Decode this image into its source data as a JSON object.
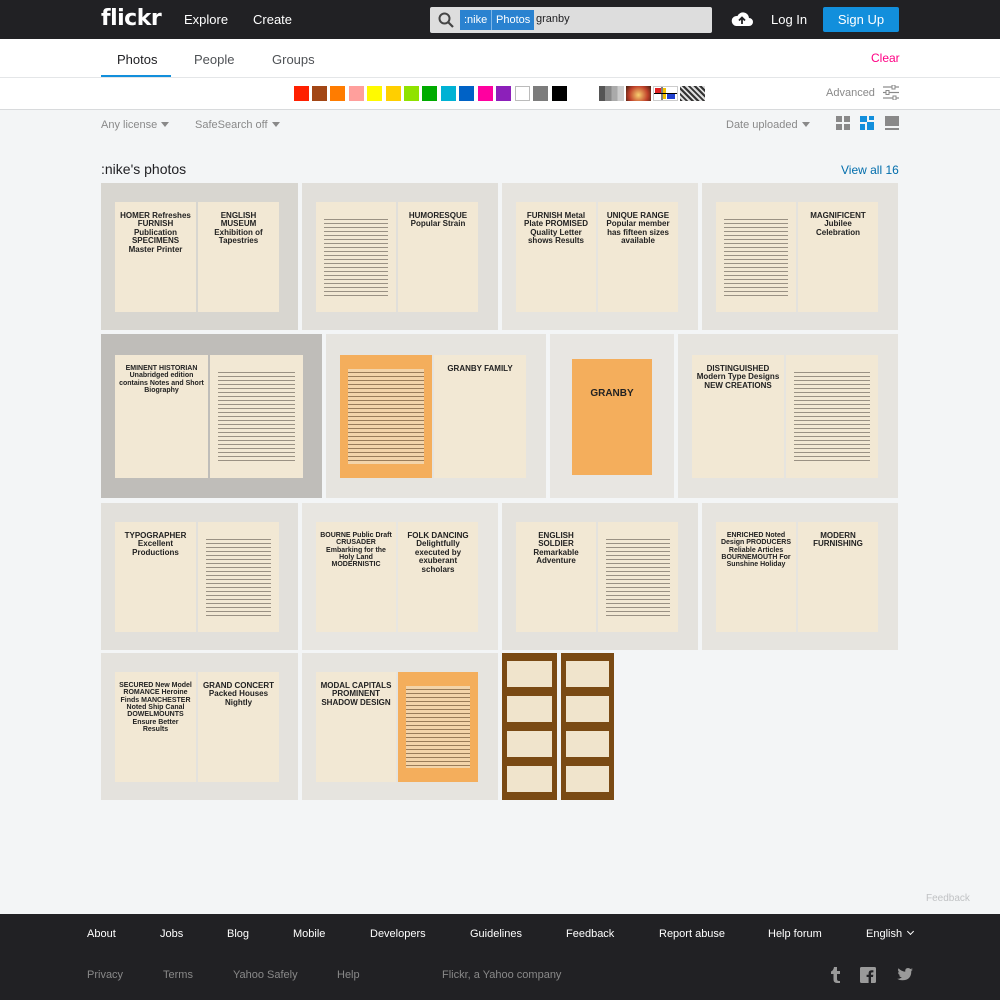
{
  "header": {
    "logo": "flickr",
    "nav": [
      "Explore",
      "Create"
    ],
    "search": {
      "token_user": ":nike",
      "token_scope": "Photos",
      "query": "granby"
    },
    "login": "Log In",
    "signup": "Sign Up"
  },
  "tabs": {
    "items": [
      "Photos",
      "People",
      "Groups"
    ],
    "active": "Photos",
    "clear": "Clear"
  },
  "color_filters": {
    "swatches": [
      "#ff2000",
      "#a24615",
      "#ff7c00",
      "#ff9f9c",
      "#fffa00",
      "#ffcf00",
      "#90e200",
      "#00ab00",
      "#00b2d4",
      "#0062c6",
      "#ff009f",
      "#8c20ba",
      "#ffffff",
      "#7c7c7c",
      "#000000"
    ],
    "styles": [
      "black-and-white",
      "shallow-depth-of-field",
      "minimalist",
      "patterns"
    ],
    "advanced": "Advanced"
  },
  "filters": {
    "license": "Any license",
    "safesearch": "SafeSearch off",
    "sort": "Date uploaded"
  },
  "results": {
    "title": ":nike's photos",
    "view_all": "View all 16",
    "thumbs": [
      {
        "left": "HOMER Refreshes FURNISH Publication SPECIMENS Master Printer",
        "right": "ENGLISH MUSEUM Exhibition of Tapestries"
      },
      {
        "left": "",
        "right": "HUMORESQUE Popular Strain"
      },
      {
        "left": "FURNISH Metal Plate PROMISED Quality Letter shows Results",
        "right": "UNIQUE RANGE Popular member has fifteen sizes available"
      },
      {
        "left": "",
        "right": "MAGNIFICENT Jubilee Celebration"
      },
      {
        "left": "EMINENT HISTORIAN Unabridged edition contains Notes and Short Biography",
        "right": ""
      },
      {
        "left": "",
        "right": "GRANBY FAMILY"
      },
      {
        "left": "GRANBY",
        "right": ""
      },
      {
        "left": "DISTINGUISHED Modern Type Designs NEW CREATIONS",
        "right": ""
      },
      {
        "left": "TYPOGRAPHER Excellent Productions",
        "right": ""
      },
      {
        "left": "BOURNE Public Draft CRUSADER Embarking for the Holy Land MODERNISTIC",
        "right": "FOLK DANCING Delightfully executed by exuberant scholars"
      },
      {
        "left": "ENGLISH SOLDIER Remarkable Adventure",
        "right": ""
      },
      {
        "left": "ENRICHED Noted Design PRODUCERS Reliable Articles BOURNEMOUTH For Sunshine Holiday",
        "right": "MODERN FURNISHING"
      },
      {
        "left": "SECURED New Model ROMANCE Heroine Finds MANCHESTER Noted Ship Canal DOWELMOUNTS Ensure Better Results",
        "right": "GRAND CONCERT Packed Houses Nightly"
      },
      {
        "left": "MODAL CAPITALS PROMINENT SHADOW DESIGN",
        "right": ""
      },
      {
        "left": "",
        "right": ""
      },
      {
        "left": "",
        "right": ""
      }
    ]
  },
  "footer": {
    "links": [
      "About",
      "Jobs",
      "Blog",
      "Mobile",
      "Developers",
      "Guidelines",
      "Feedback",
      "Report abuse",
      "Help forum",
      "English"
    ],
    "links2": [
      "Privacy",
      "Terms",
      "Yahoo Safely",
      "Help"
    ],
    "credit": "Flickr, a Yahoo company",
    "feedback_tab": "Feedback"
  }
}
